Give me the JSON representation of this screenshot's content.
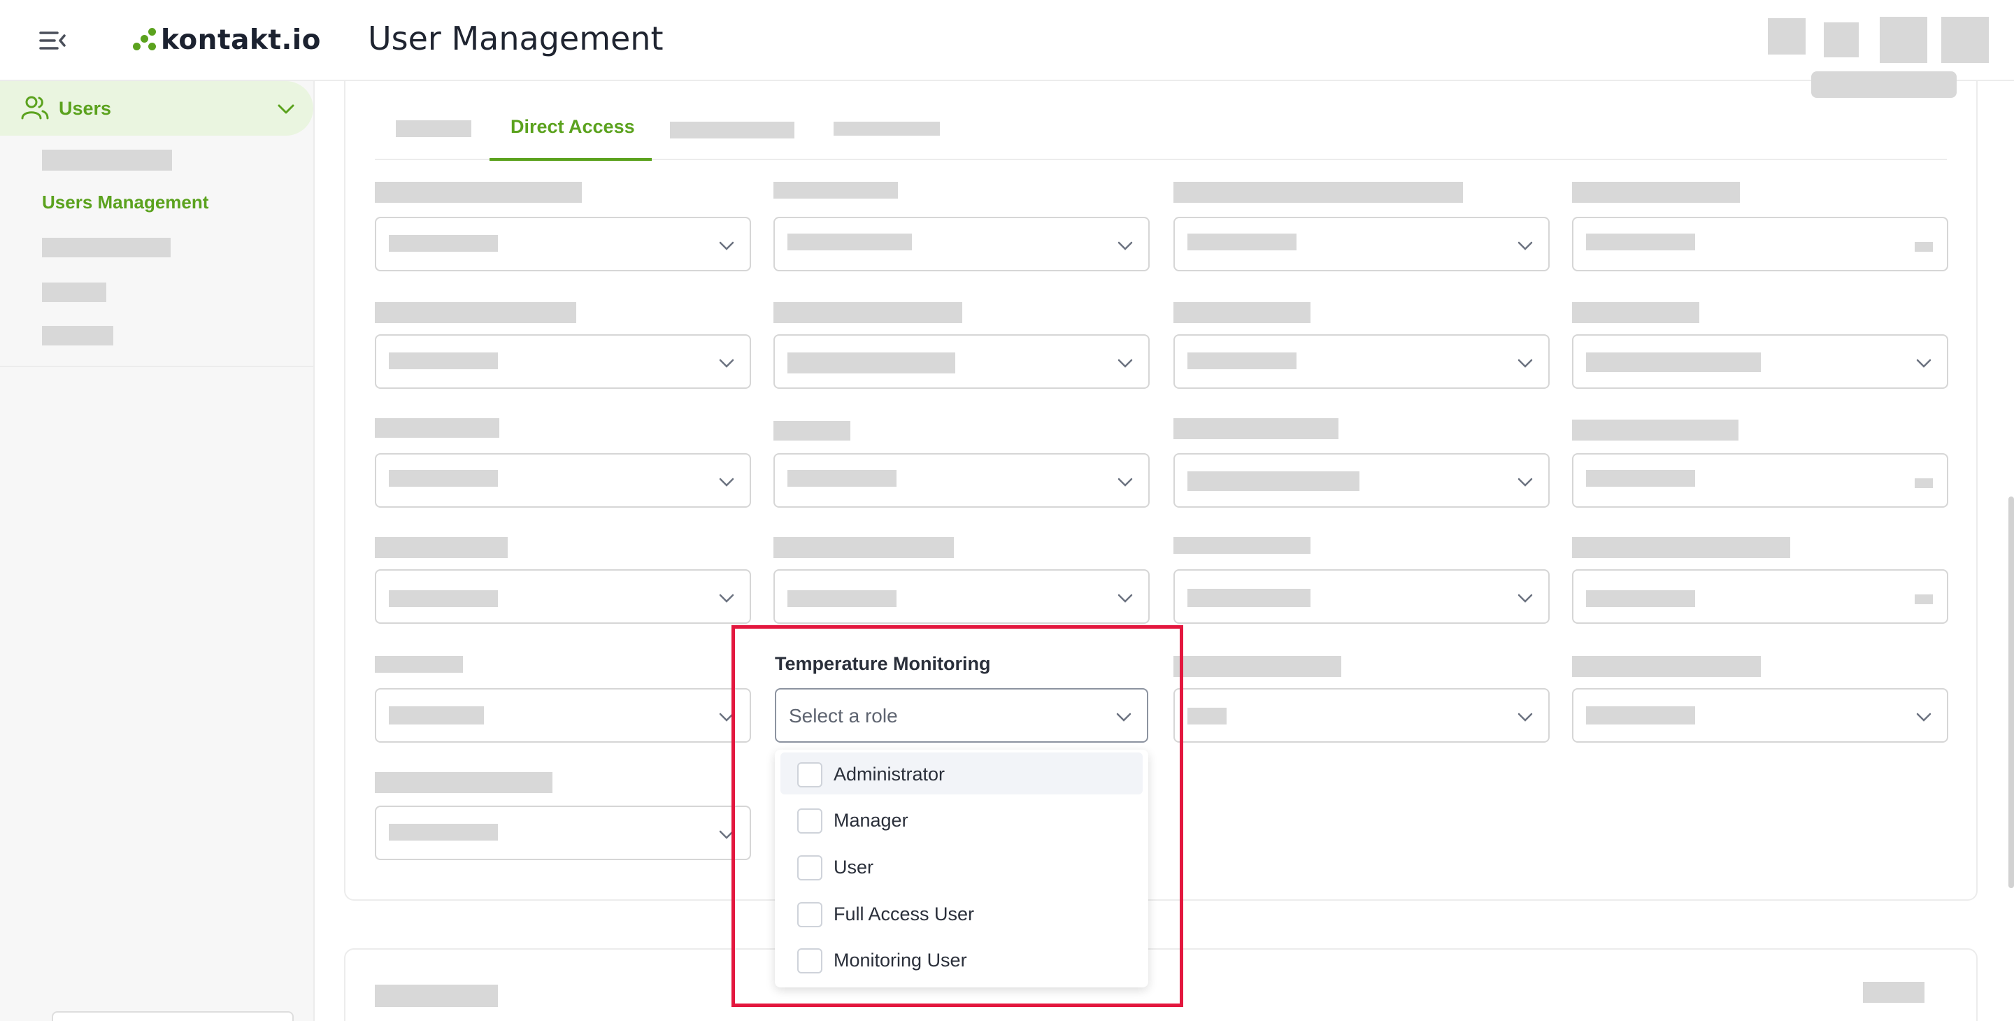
{
  "header": {
    "logo_text": "kontakt.io",
    "page_title": "User Management"
  },
  "sidebar": {
    "users_label": "Users",
    "active_item_label": "Users Management"
  },
  "tabs": {
    "active_label": "Direct Access"
  },
  "role_dropdown": {
    "label": "Temperature Monitoring",
    "placeholder": "Select a role",
    "options": [
      {
        "label": "Administrator",
        "checked": false
      },
      {
        "label": "Manager",
        "checked": false
      },
      {
        "label": "User",
        "checked": false
      },
      {
        "label": "Full Access User",
        "checked": false
      },
      {
        "label": "Monitoring User",
        "checked": false
      }
    ]
  },
  "colors": {
    "brand_green": "#5ba21e",
    "highlight_red": "#e3173e",
    "placeholder_gray": "#d8d8d8"
  },
  "icons": {
    "menu_toggle": "menu-collapse-icon",
    "users": "users-icon",
    "chevron": "chevron-down-icon"
  }
}
